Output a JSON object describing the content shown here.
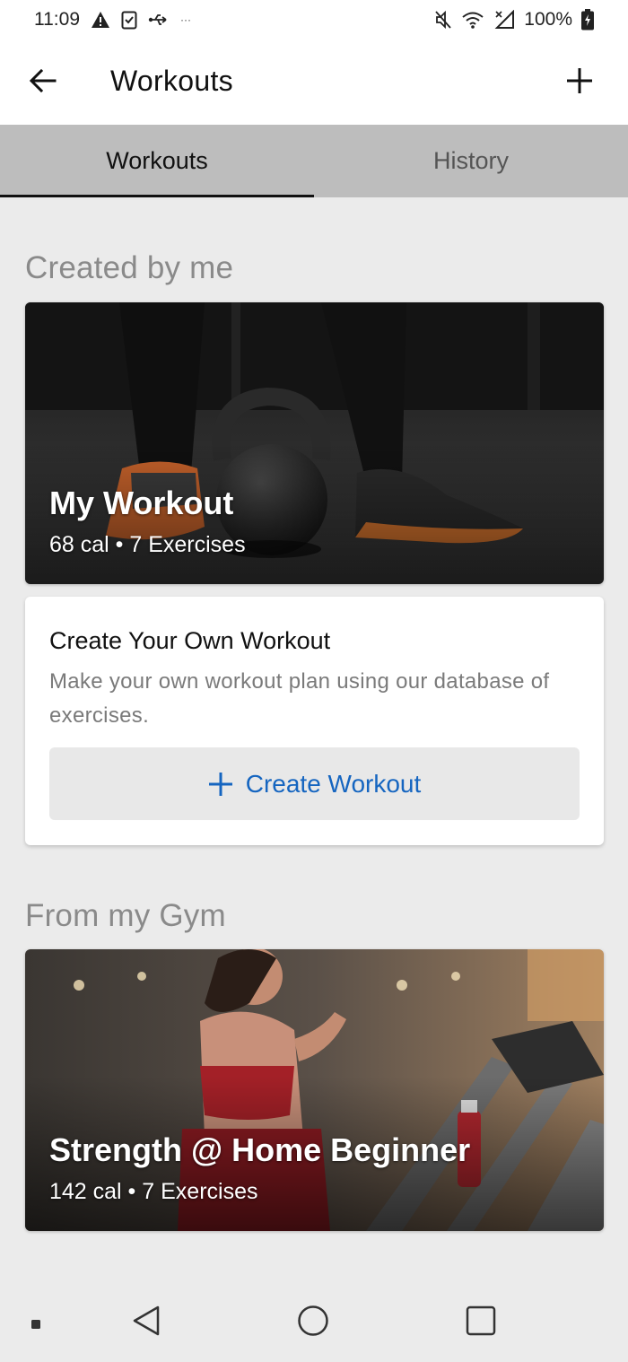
{
  "status_bar": {
    "time": "11:09",
    "ellipsis": "···",
    "battery_text": "100%",
    "icons_left": [
      "alert-icon",
      "clipboard-check-icon",
      "usb-icon"
    ],
    "icons_right": [
      "mute-icon",
      "wifi-icon",
      "signal-icon",
      "battery-icon"
    ]
  },
  "app_bar": {
    "title": "Workouts",
    "back_icon": "arrow-left-icon",
    "add_icon": "plus-icon"
  },
  "tabs": [
    {
      "label": "Workouts",
      "active": true
    },
    {
      "label": "History",
      "active": false
    }
  ],
  "sections": {
    "created_by_me": "Created by me",
    "from_my_gym": "From my Gym"
  },
  "cards": {
    "my_workout": {
      "title": "My Workout",
      "subtitle": "68 cal • 7 Exercises"
    },
    "strength": {
      "title": "Strength @ Home Beginner",
      "subtitle": "142 cal • 7 Exercises"
    }
  },
  "create_card": {
    "title": "Create Your Own Workout",
    "description": "Make your own workout plan using our database of exercises.",
    "button_label": "Create Workout"
  },
  "nav": [
    "overview-dot-icon",
    "back-triangle-icon",
    "home-circle-icon",
    "recents-square-icon"
  ],
  "colors": {
    "accent": "#1565c0",
    "tab_bar": "#bdbdbd",
    "background": "#ebebeb"
  }
}
